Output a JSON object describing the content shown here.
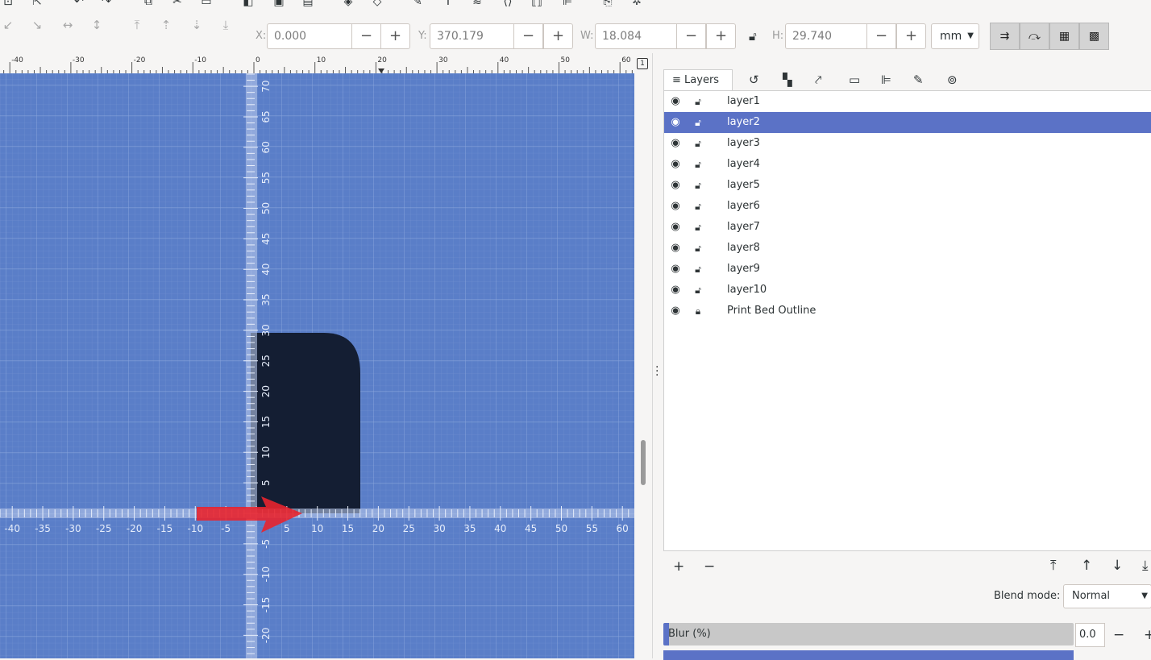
{
  "toolbar": {
    "x_label": "X:",
    "x_value": "0.000",
    "y_label": "Y:",
    "y_value": "370.179",
    "w_label": "W:",
    "w_value": "18.084",
    "h_label": "H:",
    "h_value": "29.740",
    "minus": "−",
    "plus": "+",
    "unit": "mm"
  },
  "ruler": {
    "h_ticks": [
      "-40",
      "-30",
      "-20",
      "-10",
      "0",
      "10",
      "20",
      "30",
      "40",
      "50",
      "60"
    ],
    "canvas_h_ticks": [
      "-40",
      "-35",
      "-30",
      "-25",
      "-20",
      "-15",
      "-10",
      "-5",
      "0",
      "5",
      "10",
      "15",
      "20",
      "25",
      "30",
      "35",
      "40",
      "45",
      "50",
      "55",
      "60"
    ],
    "canvas_v_ticks": [
      "70",
      "65",
      "60",
      "55",
      "50",
      "45",
      "40",
      "35",
      "30",
      "25",
      "20",
      "15",
      "10",
      "5",
      "-5",
      "-10",
      "-15",
      "-20"
    ]
  },
  "panel": {
    "active_tab": "Layers",
    "layers": [
      {
        "name": "layer1",
        "locked": false,
        "selected": false
      },
      {
        "name": "layer2",
        "locked": false,
        "selected": true
      },
      {
        "name": "layer3",
        "locked": false,
        "selected": false
      },
      {
        "name": "layer4",
        "locked": false,
        "selected": false
      },
      {
        "name": "layer5",
        "locked": false,
        "selected": false
      },
      {
        "name": "layer6",
        "locked": false,
        "selected": false
      },
      {
        "name": "layer7",
        "locked": false,
        "selected": false
      },
      {
        "name": "layer8",
        "locked": false,
        "selected": false
      },
      {
        "name": "layer9",
        "locked": false,
        "selected": false
      },
      {
        "name": "layer10",
        "locked": false,
        "selected": false
      },
      {
        "name": "Print Bed Outline",
        "locked": true,
        "selected": false
      }
    ],
    "blend_label": "Blend mode:",
    "blend_value": "Normal",
    "blur_label": "Blur (%)",
    "blur_value": "0.0",
    "add": "+",
    "remove": "−"
  },
  "colors": {
    "canvas": "#5a7ec8",
    "selection": "#5b72c6",
    "shape": "#141e33",
    "arrow": "#e8232d"
  }
}
